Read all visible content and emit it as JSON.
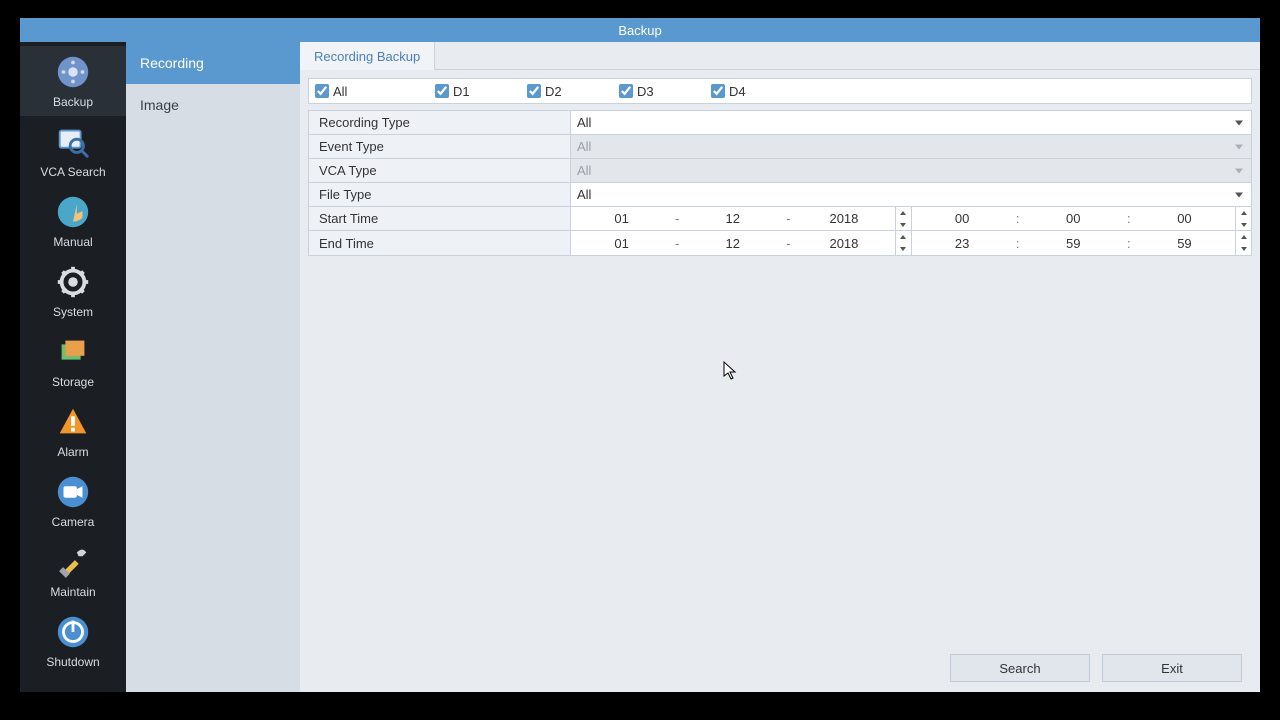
{
  "title": "Backup",
  "sidebar": [
    {
      "label": "Backup"
    },
    {
      "label": "VCA Search"
    },
    {
      "label": "Manual"
    },
    {
      "label": "System"
    },
    {
      "label": "Storage"
    },
    {
      "label": "Alarm"
    },
    {
      "label": "Camera"
    },
    {
      "label": "Maintain"
    },
    {
      "label": "Shutdown"
    }
  ],
  "subnav": [
    {
      "label": "Recording"
    },
    {
      "label": "Image"
    }
  ],
  "tab": "Recording Backup",
  "channels": {
    "all": "All",
    "d1": "D1",
    "d2": "D2",
    "d3": "D3",
    "d4": "D4"
  },
  "form": {
    "recording_type_label": "Recording Type",
    "recording_type_value": "All",
    "event_type_label": "Event Type",
    "event_type_value": "All",
    "vca_type_label": "VCA Type",
    "vca_type_value": "All",
    "file_type_label": "File Type",
    "file_type_value": "All",
    "start_time_label": "Start Time",
    "end_time_label": "End Time",
    "start_date": {
      "d": "01",
      "m": "12",
      "y": "2018"
    },
    "start_time": {
      "h": "00",
      "mi": "00",
      "s": "00"
    },
    "end_date": {
      "d": "01",
      "m": "12",
      "y": "2018"
    },
    "end_time": {
      "h": "23",
      "mi": "59",
      "s": "59"
    }
  },
  "buttons": {
    "search": "Search",
    "exit": "Exit"
  }
}
